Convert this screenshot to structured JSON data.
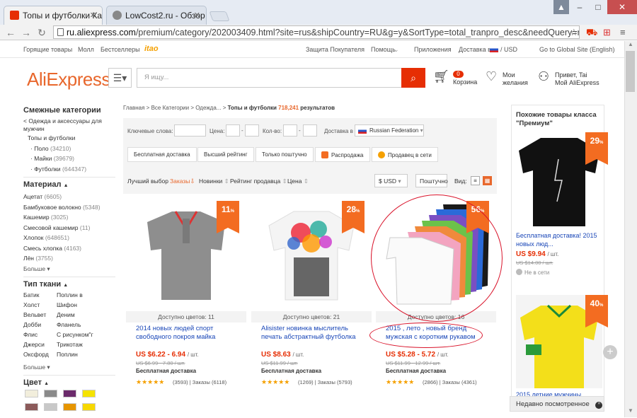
{
  "browser": {
    "tabs": [
      {
        "label": "Топы и футболки Ка",
        "active": true
      },
      {
        "label": "LowCost2.ru - Обзор",
        "active": false
      }
    ],
    "url_domain": "ru.aliexpress.com",
    "url_rest": "/premium/category/202003409.html?site=rus&shipCountry=RU&g=y&SortType=total_tranpro_desc&needQuery=n&"
  },
  "sitebar": {
    "hot": "Горящие товары",
    "mall": "Молл",
    "bestsellers": "Бестселлеры",
    "itao": "itao",
    "protection": "Защита Покупателя",
    "help": "Помощь",
    "apps": "Приложения",
    "ship_to": "Доставка в",
    "currency": "/ USD",
    "global": "Go to Global Site (English)"
  },
  "header": {
    "logo": "AliExpress",
    "search_placeholder": "Я ищу...",
    "cart_count": "0",
    "cart_label": "Корзина",
    "wish_1": "Мои",
    "wish_2": "желания",
    "user_1": "Привет, Tai",
    "user_2": "Мой AliExpress"
  },
  "left": {
    "related_title": "Смежные категории",
    "parent": "< Одежда и аксессуары для мужчин",
    "current": "Топы и футболки",
    "subs": [
      {
        "name": "Поло",
        "count": "(34210)"
      },
      {
        "name": "Майки",
        "count": "(39679)"
      },
      {
        "name": "Футболки",
        "count": "(644347)"
      }
    ],
    "material_title": "Материал",
    "materials": [
      {
        "name": "Ацетат",
        "count": "(6605)"
      },
      {
        "name": "Бамбуковое волокно",
        "count": "(5348)"
      },
      {
        "name": "Кашемир",
        "count": "(3025)"
      },
      {
        "name": "Смесовой кашемир",
        "count": "(11)"
      },
      {
        "name": "Хлопок",
        "count": "(648651)"
      },
      {
        "name": "Смесь хлопка",
        "count": "(4163)"
      },
      {
        "name": "Лён",
        "count": "(3755)"
      }
    ],
    "more": "Больше",
    "fabric_title": "Тип ткани",
    "fabrics": [
      "Батик",
      "Поплин в",
      "Холст",
      "Шифон",
      "Вельвет",
      "Деним",
      "Добби",
      "Фланель",
      "Флис",
      "С рисунком\"г",
      "Джерси",
      "Трикотаж",
      "Оксфорд",
      "Поплин"
    ],
    "color_title": "Цвет",
    "swatches": [
      "#f2eedc",
      "#8a8a8a",
      "#6b2a6b",
      "#f5e300",
      "#8b5a5a",
      "#c8c8c8",
      "#e69500",
      "#f7d800"
    ]
  },
  "crumbs": {
    "home": "Главная",
    "all": "Все Категории",
    "clothes": "Одежда...",
    "current": "Топы и футболки",
    "count": "718,241",
    "results": "результатов"
  },
  "filter": {
    "keywords": "Ключевые слова:",
    "price": "Цена:",
    "qty": "Кол-во:",
    "ship_to": "Доставка в",
    "country": "Russian Federation",
    "btns": [
      "Бесплатная доставка",
      "Высший рейтинг",
      "Только поштучно",
      "Распродажа",
      "Продавец в сети"
    ],
    "sorts": [
      "Лучший выбор",
      "Заказы",
      "Новинки",
      "Рейтинг продавца",
      "Цена"
    ],
    "currency": "$ USD",
    "mode": "Поштучно",
    "view": "Вид:"
  },
  "products": [
    {
      "disc": "11",
      "colors": "Доступно цветов: 11",
      "title": "2014 новых людей спорт свободного покроя майка",
      "price": "US $6.22 - 6.94",
      "unit": "/ шт.",
      "old": "US $6.99 - 7.80 / шт.",
      "ship": "Бесплатная доставка",
      "stars": "★★★★★",
      "meta": "(3593) | Заказы (6118)"
    },
    {
      "disc": "28",
      "colors": "Доступно цветов: 21",
      "title": "Alisister новинка мыслитель печать абстрактный футболка",
      "price": "US $8.63",
      "unit": "/ шт.",
      "old": "US $11.99 / шт.",
      "ship": "Бесплатная доставка",
      "stars": "★★★★★",
      "meta": "(1269) | Заказы (5793)"
    },
    {
      "disc": "56",
      "colors": "Доступно цветов: 16",
      "title": "2015 , лето , новый бренд мужская с коротким рукавом",
      "price": "US $5.28 - 5.72",
      "unit": "/ шт.",
      "old": "US $11.99 - 12.99 / шт.",
      "ship": "Бесплатная доставка",
      "stars": "★★★★★",
      "meta": "(2866) | Заказы (4361)"
    }
  ],
  "right": {
    "title": "Похожие товары класса \"Премиум\"",
    "disc1": "29",
    "text1": "Бесплатная доставка! 2015 новых люд...",
    "price1": "US $9.94",
    "unit1": "/ шт.",
    "old1": "US $14.00 / шт.",
    "offline": "Не в сети",
    "disc2": "40",
    "text2": "2015 летние мужчины"
  },
  "recent": "Недавно посмотренное",
  "colors": {
    "accent": "#e8672c",
    "red": "#e62e04",
    "link": "#1a47b8",
    "annotation": "#d9132a"
  }
}
